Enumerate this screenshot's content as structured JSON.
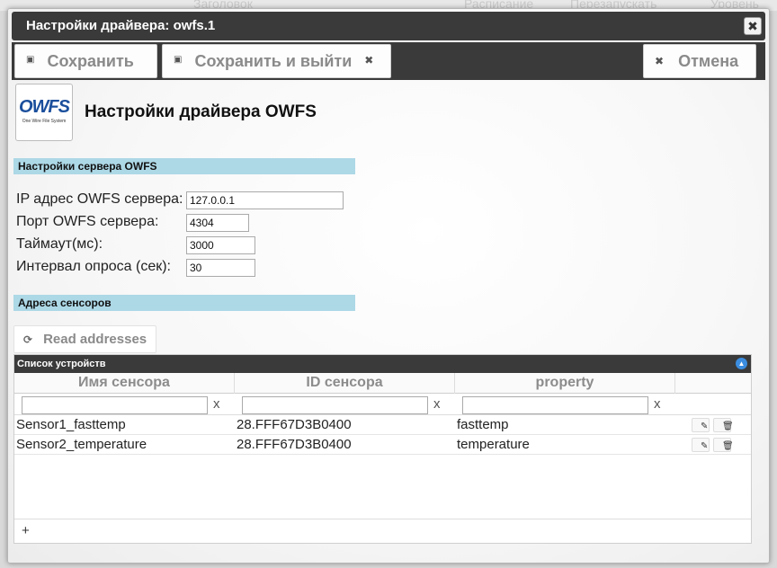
{
  "background_headers": [
    "Заголовок",
    "Расписание",
    "Перезапускать",
    "Уровень"
  ],
  "dialog": {
    "title": "Настройки драйвера: owfs.1",
    "close_icon": "close-icon"
  },
  "toolbar": {
    "save_label": "Сохранить",
    "save_exit_label": "Сохранить и выйти",
    "cancel_label": "Отмена"
  },
  "header": {
    "logo_text": "OWFS",
    "logo_subtext": "One Wire File System",
    "title": "Настройки драйвера OWFS"
  },
  "server_section": {
    "title": "Настройки сервера OWFS",
    "fields": [
      {
        "label": "IP адрес OWFS сервера:",
        "value": "127.0.0.1"
      },
      {
        "label": "Порт OWFS сервера:",
        "value": "4304"
      },
      {
        "label": "Таймаут(мс):",
        "value": "3000"
      },
      {
        "label": "Интервал опроса (сек):",
        "value": "30"
      }
    ]
  },
  "sensors_section": {
    "title": "Адреса сенсоров",
    "read_button": "Read addresses"
  },
  "grid": {
    "caption": "Список устройств",
    "columns": [
      "Имя сенсора",
      "ID сенсора",
      "property"
    ],
    "filter_clear": "x",
    "rows": [
      {
        "name": "Sensor1_fasttemp",
        "id": "28.FFF67D3B0400",
        "property": "fasttemp"
      },
      {
        "name": "Sensor2_temperature",
        "id": "28.FFF67D3B0400",
        "property": "temperature"
      }
    ],
    "add_label": "+"
  },
  "colors": {
    "dark_bar": "#3a3a3a",
    "section_header": "#add8e6",
    "accent_blue": "#3b8de0"
  }
}
